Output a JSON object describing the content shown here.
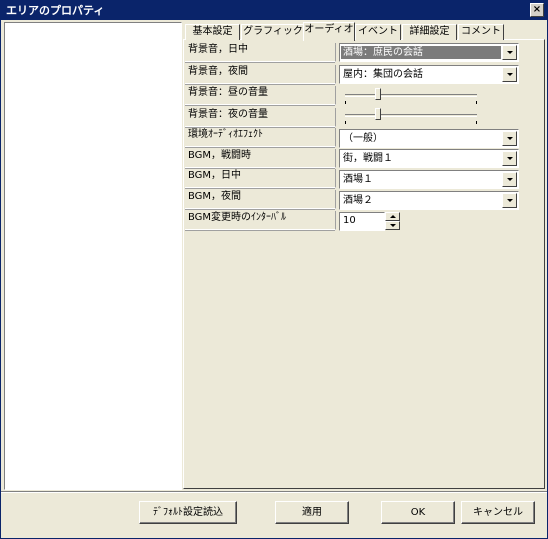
{
  "window": {
    "title": "エリアのプロパティ",
    "close_symbol": "×"
  },
  "tabs": [
    {
      "label": "基本設定"
    },
    {
      "label": "グラフィック"
    },
    {
      "label": "オーディオ",
      "active": true
    },
    {
      "label": "イベント"
    },
    {
      "label": "詳細設定"
    },
    {
      "label": "コメント"
    }
  ],
  "audio": {
    "bg_day": {
      "label": "背景音，日中",
      "value": "酒場：庶民の会話"
    },
    "bg_night": {
      "label": "背景音，夜間",
      "value": "屋内：集団の会話"
    },
    "bg_day_volume": {
      "label": "背景音：昼の音量",
      "level": 0.25
    },
    "bg_night_volume": {
      "label": "背景音：夜の音量",
      "level": 0.25
    },
    "env_effect": {
      "label": "環境ｵｰﾃﾞｨｵｴﾌｪｸﾄ",
      "value": "（一般）"
    },
    "bgm_battle": {
      "label": "BGM，戦闘時",
      "value": "街，戦闘１"
    },
    "bgm_day": {
      "label": "BGM，日中",
      "value": "酒場１"
    },
    "bgm_night": {
      "label": "BGM，夜間",
      "value": "酒場２"
    },
    "bgm_interval": {
      "label": "BGM変更時のｲﾝﾀｰﾊﾞﾙ",
      "value": "10"
    }
  },
  "buttons": {
    "load_defaults": "ﾃﾞﾌｫﾙﾄ設定読込",
    "apply": "適用",
    "ok": "OK",
    "cancel": "キャンセル"
  }
}
